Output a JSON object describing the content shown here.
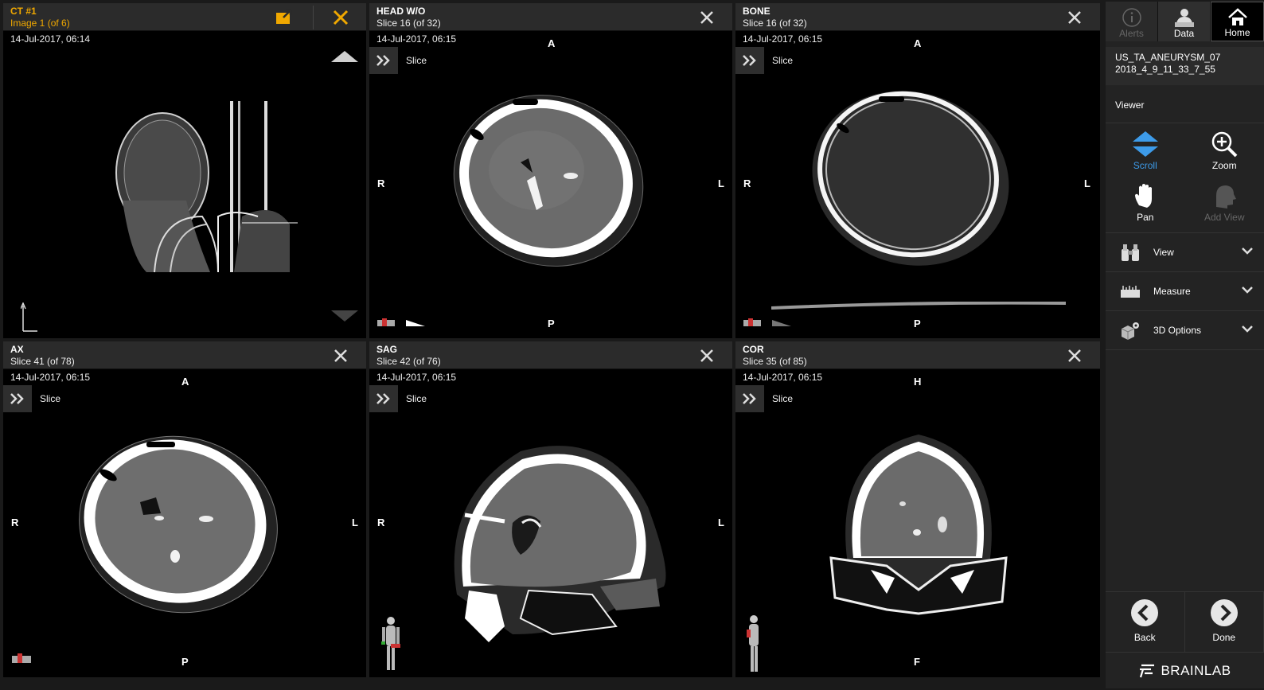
{
  "panels": [
    {
      "title": "CT #1",
      "subtitle": "Image 1 (of 6)",
      "date": "14-Jul-2017, 06:14"
    },
    {
      "title": "HEAD W/O",
      "subtitle": "Slice 16 (of 32)",
      "date": "14-Jul-2017, 06:15",
      "slice_label": "Slice",
      "orient": {
        "top": "A",
        "bottom": "P",
        "left": "R",
        "right": "L"
      }
    },
    {
      "title": "BONE",
      "subtitle": "Slice 16 (of 32)",
      "date": "14-Jul-2017, 06:15",
      "slice_label": "Slice",
      "orient": {
        "top": "A",
        "bottom": "P",
        "left": "R",
        "right": "L"
      }
    },
    {
      "title": "AX",
      "subtitle": "Slice 41 (of 78)",
      "date": "14-Jul-2017, 06:15",
      "slice_label": "Slice",
      "orient": {
        "top": "A",
        "bottom": "P",
        "left": "R",
        "right": "L"
      }
    },
    {
      "title": "SAG",
      "subtitle": "Slice 42 (of 76)",
      "date": "14-Jul-2017, 06:15",
      "slice_label": "Slice",
      "orient": {
        "left": "R",
        "right": "L"
      }
    },
    {
      "title": "COR",
      "subtitle": "Slice 35 (of 85)",
      "date": "14-Jul-2017, 06:15",
      "slice_label": "Slice",
      "orient": {
        "top": "H",
        "bottom": "F"
      }
    }
  ],
  "sidebar": {
    "nav": {
      "alerts": "Alerts",
      "data": "Data",
      "home": "Home"
    },
    "study": {
      "line1": "US_TA_ANEURYSM_07",
      "line2": "2018_4_9_11_33_7_55"
    },
    "section": "Viewer",
    "tools": {
      "scroll": "Scroll",
      "zoom": "Zoom",
      "pan": "Pan",
      "add_view": "Add View"
    },
    "menus": {
      "view": "View",
      "measure": "Measure",
      "options": "3D Options"
    },
    "back": "Back",
    "done": "Done",
    "brand": "BRAINLAB"
  },
  "colors": {
    "accent_orange": "#f0a800",
    "active_blue": "#3d9be9",
    "panel_header": "#2b2b2b"
  }
}
